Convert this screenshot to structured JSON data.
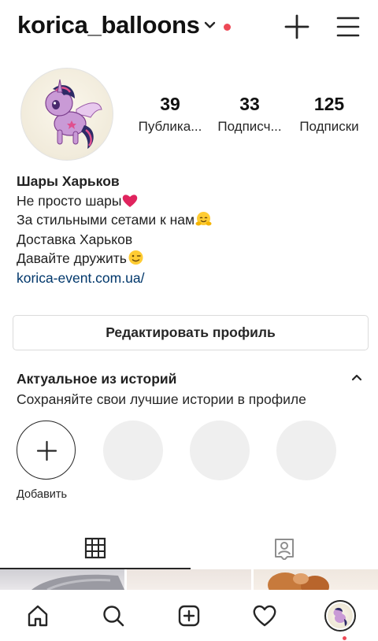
{
  "header": {
    "username": "korica_balloons",
    "chevron_icon": "chevron-down-icon",
    "notification_color": "#ed4956",
    "new_post_icon": "plus-icon",
    "menu_icon": "hamburger-menu-icon"
  },
  "profile": {
    "avatar_icon": "pony-avatar",
    "stats": [
      {
        "value": "39",
        "label": "Публика..."
      },
      {
        "value": "33",
        "label": "Подписч..."
      },
      {
        "value": "125",
        "label": "Подписки"
      }
    ]
  },
  "bio": {
    "name": "Шары Харьков",
    "line1": "Не просто шары",
    "line2": "За стильными сетами к нам",
    "line3": "Доставка Харьков",
    "line4": "Давайте дружить",
    "link": "korica-event.com.ua/",
    "emoji_icons": [
      "red-heart-emoji",
      "hugging-face-emoji",
      "winking-face-emoji"
    ]
  },
  "edit_profile": {
    "label": "Редактировать профиль"
  },
  "highlights": {
    "title": "Актуальное из историй",
    "subtitle": "Сохраняйте свои лучшие истории в профиле",
    "add_label": "Добавить"
  },
  "tabs": [
    {
      "icon": "grid-icon",
      "active": true
    },
    {
      "icon": "tagged-person-icon",
      "active": false
    }
  ],
  "bottom_nav": [
    {
      "icon": "home-icon"
    },
    {
      "icon": "search-icon"
    },
    {
      "icon": "new-post-icon"
    },
    {
      "icon": "heart-icon"
    },
    {
      "icon": "profile-avatar-icon"
    }
  ],
  "colors": {
    "text": "#262626",
    "link": "#00376b",
    "border": "#dbdbdb",
    "placeholder": "#efefef",
    "accent_red": "#ed4956"
  }
}
